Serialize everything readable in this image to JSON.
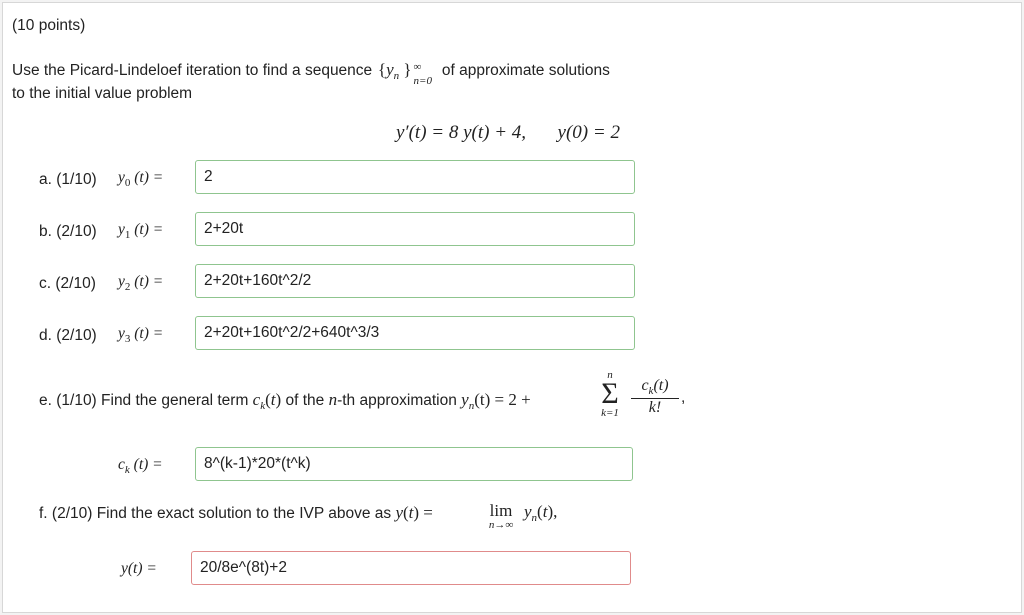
{
  "header": {
    "points": "(10 points)",
    "intro_line1": "Use the Picard-Lindeloef iteration to find a sequence",
    "intro_line1_tail": "of approximate solutions",
    "intro_line2": "to the initial value problem"
  },
  "ivp": {
    "ode": "y′(t) = 8 y(t) + 4,",
    "ic": "y(0) = 2"
  },
  "parts": [
    {
      "label": "a. (1/10)",
      "lhs": "y",
      "sub": "0",
      "arg": "(t) =",
      "value": "2"
    },
    {
      "label": "b. (2/10)",
      "lhs": "y",
      "sub": "1",
      "arg": "(t) =",
      "value": "2+20t"
    },
    {
      "label": "c. (2/10)",
      "lhs": "y",
      "sub": "2",
      "arg": "(t) =",
      "value": "2+20t+160t^2/2"
    },
    {
      "label": "d. (2/10)",
      "lhs": "y",
      "sub": "3",
      "arg": "(t) =",
      "value": "2+20t+160t^2/2+640t^3/3"
    }
  ],
  "part_e": {
    "label": "e. (1/10) Find the general term",
    "mid": "of the",
    "mid2": "-th approximation",
    "eq": "(t) = 2 +",
    "sum_top": "n",
    "sum_bottom": "k=1",
    "frac_num": "c",
    "frac_num_tail": "(t)",
    "frac_den": "k!",
    "ck_lhs": "(t) =",
    "value": "8^(k-1)*20*(t^k)"
  },
  "part_f": {
    "label": "f. (2/10) Find the exact solution to the IVP above as",
    "lim": "lim",
    "lim_sub": "n→∞",
    "y_lhs": "y(t) =",
    "value": "20/8e^(8t)+2"
  }
}
